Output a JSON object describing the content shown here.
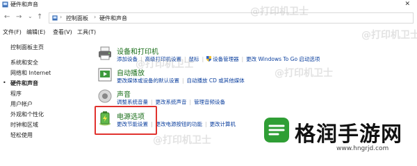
{
  "window": {
    "title": "硬件和声音",
    "close": "✕"
  },
  "address": {
    "back": "←",
    "forward": "→",
    "dropdown": "⌄",
    "up": "↑",
    "crumbs": [
      "控制面板",
      "硬件和声音"
    ],
    "sep": "›"
  },
  "menu": [
    "文件(F)",
    "编辑(E)",
    "查看(V)",
    "工具(T)"
  ],
  "sidebar": {
    "items": [
      "控制面板主页",
      "系统和安全",
      "网络和 Internet",
      "硬件和声音",
      "程序",
      "用户帐户",
      "外观和个性化",
      "时钟和区域",
      "轻松使用"
    ],
    "active_index": 3,
    "bullet": "•"
  },
  "categories": [
    {
      "title": "设备和打印机",
      "links": [
        "添加设备",
        "高级打印机设置",
        "鼠标",
        "设备管理器",
        "更改 Windows To Go 启动选项"
      ],
      "shield_link_index": 3
    },
    {
      "title": "自动播放",
      "links": [
        "更改媒体或设备的默认设置",
        "自动播放 CD 或其他媒体"
      ]
    },
    {
      "title": "声音",
      "links": [
        "调整系统音量",
        "更改系统声音",
        "管理音频设备"
      ]
    },
    {
      "title": "电源选项",
      "links": [
        "更改节能设置",
        "更改电源按钮的功能",
        "更改计算机"
      ]
    }
  ],
  "watermark": "@打印机卫士",
  "brand": {
    "name": "格润手游网",
    "url": "www.hngrjd.com"
  },
  "colors": {
    "category_title": "#1a6e1a",
    "link": "#0b3f9e",
    "highlight": "#e0312d",
    "brand_green": "#2f9e35"
  }
}
